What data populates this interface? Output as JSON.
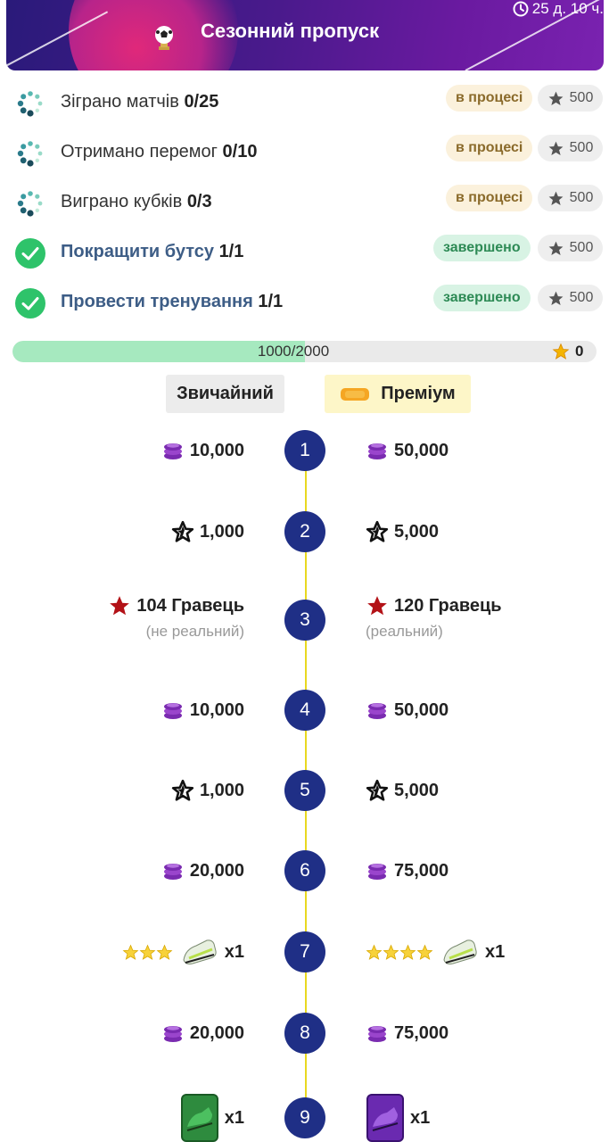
{
  "header": {
    "title": "Сезонний пропуск",
    "timer": "25 д. 10 ч."
  },
  "tasks": [
    {
      "label": "Зіграно матчів",
      "count": "0/25",
      "status": "в процесі",
      "points": "500",
      "done": false
    },
    {
      "label": "Отримано перемог",
      "count": "0/10",
      "status": "в процесі",
      "points": "500",
      "done": false
    },
    {
      "label": "Виграно кубків",
      "count": "0/3",
      "status": "в процесі",
      "points": "500",
      "done": false
    },
    {
      "label": "Покращити бутсу",
      "count": "1/1",
      "status": "завершено",
      "points": "500",
      "done": true
    },
    {
      "label": "Провести тренування",
      "count": "1/1",
      "status": "завершено",
      "points": "500",
      "done": true
    }
  ],
  "progress": {
    "text": "1000/2000",
    "fraction": 0.5,
    "stars": "0"
  },
  "tabs": {
    "normal": "Звичайний",
    "premium": "Преміум"
  },
  "levels": [
    {
      "num": "1",
      "normal": {
        "icon": "coins-icon",
        "text": "10,000"
      },
      "premium": {
        "icon": "coins-icon",
        "text": "50,000"
      }
    },
    {
      "num": "2",
      "normal": {
        "icon": "star-outline-icon",
        "text": "1,000"
      },
      "premium": {
        "icon": "star-outline-icon",
        "text": "5,000"
      }
    },
    {
      "num": "3",
      "normal": {
        "icon": "red-star-icon",
        "text": "104 Гравець",
        "sub": "(не реальний)"
      },
      "premium": {
        "icon": "red-star-icon",
        "text": "120 Гравець",
        "sub": "(реальний)"
      }
    },
    {
      "num": "4",
      "normal": {
        "icon": "coins-icon",
        "text": "10,000"
      },
      "premium": {
        "icon": "coins-icon",
        "text": "50,000"
      }
    },
    {
      "num": "5",
      "normal": {
        "icon": "star-outline-icon",
        "text": "1,000"
      },
      "premium": {
        "icon": "star-outline-icon",
        "text": "5,000"
      }
    },
    {
      "num": "6",
      "normal": {
        "icon": "coins-icon",
        "text": "20,000"
      },
      "premium": {
        "icon": "coins-icon",
        "text": "75,000"
      }
    },
    {
      "num": "7",
      "normal": {
        "icon": "boot-icon",
        "stars": 3,
        "text": "x1"
      },
      "premium": {
        "icon": "boot-icon",
        "stars": 4,
        "text": "x1"
      }
    },
    {
      "num": "8",
      "normal": {
        "icon": "coins-icon",
        "text": "20,000"
      },
      "premium": {
        "icon": "coins-icon",
        "text": "75,000"
      }
    },
    {
      "num": "9",
      "normal": {
        "icon": "green-card-icon",
        "text": "x1"
      },
      "premium": {
        "icon": "purple-card-icon",
        "text": "x1"
      }
    }
  ],
  "colors": {
    "header_start": "#2a1a7a",
    "header_end": "#7a22b0",
    "level_circle": "#1f2f86",
    "track_line": "#e8d820",
    "progress_fill": "#a6e9bf",
    "done_check": "#2ec36a",
    "coin_purple": "#7a2bb0"
  }
}
